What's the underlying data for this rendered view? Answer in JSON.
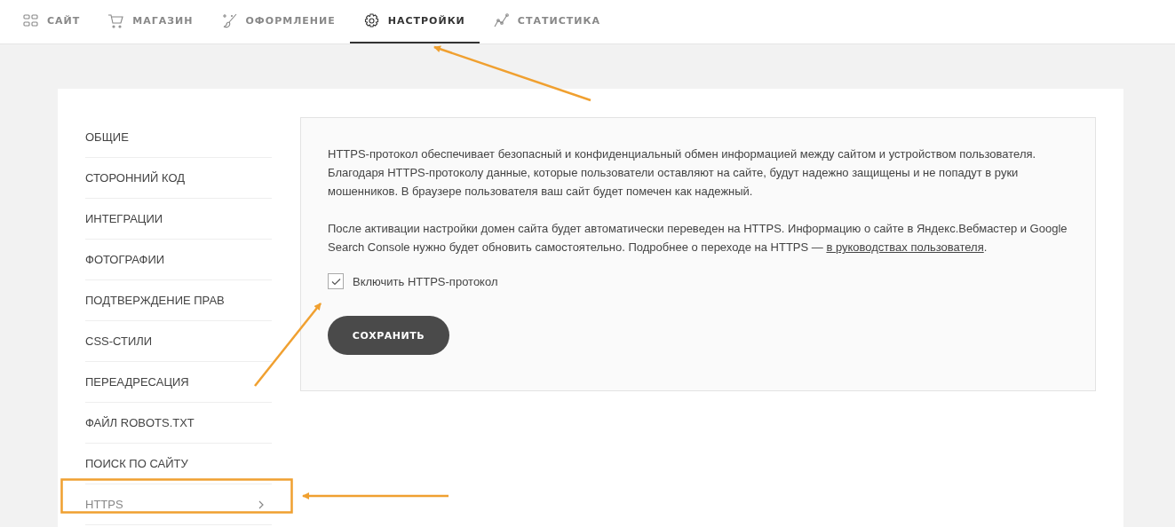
{
  "nav": [
    {
      "label": "САЙТ",
      "selected": false
    },
    {
      "label": "МАГАЗИН",
      "selected": false
    },
    {
      "label": "ОФОРМЛЕНИЕ",
      "selected": false
    },
    {
      "label": "НАСТРОЙКИ",
      "selected": true
    },
    {
      "label": "СТАТИСТИКА",
      "selected": false
    }
  ],
  "sidebar": {
    "items": [
      {
        "label": "ОБЩИЕ",
        "selected": false
      },
      {
        "label": "СТОРОННИЙ КОД",
        "selected": false
      },
      {
        "label": "ИНТЕГРАЦИИ",
        "selected": false
      },
      {
        "label": "ФОТОГРАФИИ",
        "selected": false
      },
      {
        "label": "ПОДТВЕРЖДЕНИЕ ПРАВ",
        "selected": false
      },
      {
        "label": "CSS-СТИЛИ",
        "selected": false
      },
      {
        "label": "ПЕРЕАДРЕСАЦИЯ",
        "selected": false
      },
      {
        "label": "ФАЙЛ ROBOTS.TXT",
        "selected": false
      },
      {
        "label": "ПОИСК ПО САЙТУ",
        "selected": false
      },
      {
        "label": "HTTPS",
        "selected": true
      }
    ]
  },
  "panel": {
    "paragraphs": [
      {
        "text": "HTTPS-протокол обеспечивает безопасный и конфиденциальный обмен информацией между сайтом и устройством пользователя. Благодаря HTTPS-протоколу данные, которые пользователи оставляют на сайте, будут надежно защищены и не попадут в руки мошенников. В браузере пользователя ваш сайт будет помечен как надежный."
      },
      {
        "text": "После активации настройки домен сайта будет автоматически переведен на HTTPS. Информацию о сайте в Яндекс.Вебмастер и Google Search Console нужно будет обновить самостоятельно. Подробнее о переходе на HTTPS — ",
        "link": "в руководствах пользователя",
        "after": "."
      }
    ],
    "checkbox": {
      "label": "Включить HTTPS-протокол",
      "checked": true
    },
    "save_button": "СОХРАНИТЬ"
  }
}
